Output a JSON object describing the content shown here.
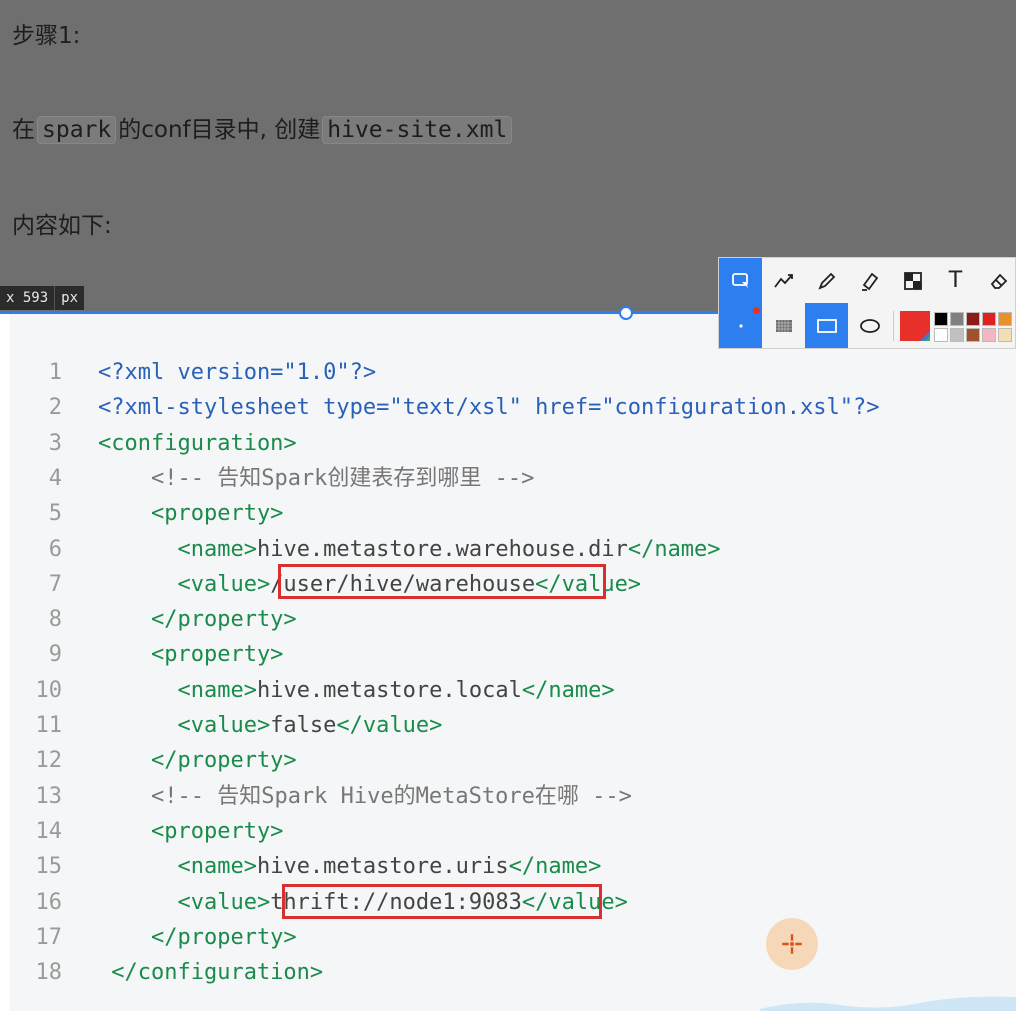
{
  "document": {
    "step_label": "步骤1:",
    "instruction": {
      "prefix": "在",
      "code1": "spark",
      "middle": "的conf目录中, 创建",
      "code2": "hive-site.xml"
    },
    "content_label": "内容如下:"
  },
  "selection": {
    "size_readout_x": "x 593",
    "size_unit": "px"
  },
  "code_block": {
    "lines": [
      {
        "n": "1",
        "parts": [
          {
            "t": "<?xml version=\"1.0\"?>",
            "c": "c-decl"
          }
        ]
      },
      {
        "n": "2",
        "parts": [
          {
            "t": "<?xml-stylesheet type=\"text/xsl\" href=\"configuration.xsl\"?>",
            "c": "c-decl"
          }
        ]
      },
      {
        "n": "3",
        "parts": [
          {
            "t": "<configuration>",
            "c": "c-tag"
          }
        ]
      },
      {
        "n": "4",
        "parts": [
          {
            "t": "    <!-- 告知Spark创建表存到哪里 -->",
            "c": "c-comment"
          }
        ]
      },
      {
        "n": "5",
        "parts": [
          {
            "t": "    <property>",
            "c": "c-tag"
          }
        ]
      },
      {
        "n": "6",
        "parts": [
          {
            "t": "      <name>",
            "c": "c-tag"
          },
          {
            "t": "hive.metastore.warehouse.dir",
            "c": "c-text"
          },
          {
            "t": "</name>",
            "c": "c-tag"
          }
        ]
      },
      {
        "n": "7",
        "parts": [
          {
            "t": "      <value>",
            "c": "c-tag"
          },
          {
            "t": "/user/hive/warehouse",
            "c": "c-text"
          },
          {
            "t": "</value>",
            "c": "c-tag"
          }
        ]
      },
      {
        "n": "8",
        "parts": [
          {
            "t": "    </property>",
            "c": "c-tag"
          }
        ]
      },
      {
        "n": "9",
        "parts": [
          {
            "t": "    <property>",
            "c": "c-tag"
          }
        ]
      },
      {
        "n": "10",
        "parts": [
          {
            "t": "      <name>",
            "c": "c-tag"
          },
          {
            "t": "hive.metastore.local",
            "c": "c-text"
          },
          {
            "t": "</name>",
            "c": "c-tag"
          }
        ]
      },
      {
        "n": "11",
        "parts": [
          {
            "t": "      <value>",
            "c": "c-tag"
          },
          {
            "t": "false",
            "c": "c-text"
          },
          {
            "t": "</value>",
            "c": "c-tag"
          }
        ]
      },
      {
        "n": "12",
        "parts": [
          {
            "t": "    </property>",
            "c": "c-tag"
          }
        ]
      },
      {
        "n": "13",
        "parts": [
          {
            "t": "    <!-- 告知Spark Hive的MetaStore在哪 -->",
            "c": "c-comment"
          }
        ]
      },
      {
        "n": "14",
        "parts": [
          {
            "t": "    <property>",
            "c": "c-tag"
          }
        ]
      },
      {
        "n": "15",
        "parts": [
          {
            "t": "      <name>",
            "c": "c-tag"
          },
          {
            "t": "hive.metastore.uris",
            "c": "c-text"
          },
          {
            "t": "</name>",
            "c": "c-tag"
          }
        ]
      },
      {
        "n": "16",
        "parts": [
          {
            "t": "      <value>",
            "c": "c-tag"
          },
          {
            "t": "thrift://node1:9083",
            "c": "c-text"
          },
          {
            "t": "</value>",
            "c": "c-tag"
          }
        ]
      },
      {
        "n": "17",
        "parts": [
          {
            "t": "    </property>",
            "c": "c-tag"
          }
        ]
      },
      {
        "n": "18",
        "parts": [
          {
            "t": " </configuration>",
            "c": "c-tag"
          }
        ]
      }
    ]
  },
  "toolbar": {
    "tools_row1": [
      "rectangle-select-icon",
      "line-icon",
      "pencil-icon",
      "highlighter-icon",
      "mosaic-icon",
      "text-tool-icon",
      "eraser-icon"
    ],
    "tools_row2": [
      "dot-size-icon",
      "fill-pattern-icon",
      "rectangle-shape-icon",
      "ellipse-shape-icon"
    ],
    "text_tool_glyph": "T",
    "selected_color": "#e8302a",
    "palette": [
      "#000000",
      "#808080",
      "#8b1a1a",
      "#e02020",
      "#e8902a",
      "#ffffff",
      "#c0c0c0",
      "#a0522d",
      "#f4b6c2",
      "#f5deb3"
    ]
  },
  "colors": {
    "accent": "#2d7ff0",
    "highlight_box": "#d63031",
    "xml_tag": "#1a8b4b",
    "xml_decl": "#2a61b8"
  }
}
